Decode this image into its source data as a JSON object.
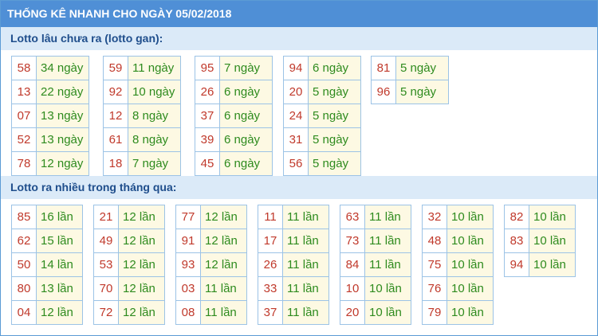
{
  "title": "THỐNG KÊ NHANH CHO NGÀY 05/02/2018",
  "gan": {
    "heading": "Lotto lâu chưa ra (lotto gan):",
    "groups": [
      [
        [
          "58",
          "34 ngày"
        ],
        [
          "13",
          "22 ngày"
        ],
        [
          "07",
          "13 ngày"
        ],
        [
          "52",
          "13 ngày"
        ],
        [
          "78",
          "12 ngày"
        ]
      ],
      [
        [
          "59",
          "11 ngày"
        ],
        [
          "92",
          "10 ngày"
        ],
        [
          "12",
          "8 ngày"
        ],
        [
          "61",
          "8 ngày"
        ],
        [
          "18",
          "7 ngày"
        ]
      ],
      [
        [
          "95",
          "7 ngày"
        ],
        [
          "26",
          "6 ngày"
        ],
        [
          "37",
          "6 ngày"
        ],
        [
          "39",
          "6 ngày"
        ],
        [
          "45",
          "6 ngày"
        ]
      ],
      [
        [
          "94",
          "6 ngày"
        ],
        [
          "20",
          "5 ngày"
        ],
        [
          "24",
          "5 ngày"
        ],
        [
          "31",
          "5 ngày"
        ],
        [
          "56",
          "5 ngày"
        ]
      ],
      [
        [
          "81",
          "5 ngày"
        ],
        [
          "96",
          "5 ngày"
        ]
      ]
    ]
  },
  "nhieu": {
    "heading": "Lotto ra nhiều trong tháng qua:",
    "groups": [
      [
        [
          "85",
          "16 lần"
        ],
        [
          "62",
          "15 lần"
        ],
        [
          "50",
          "14 lần"
        ],
        [
          "80",
          "13 lần"
        ],
        [
          "04",
          "12 lần"
        ]
      ],
      [
        [
          "21",
          "12 lần"
        ],
        [
          "49",
          "12 lần"
        ],
        [
          "53",
          "12 lần"
        ],
        [
          "70",
          "12 lần"
        ],
        [
          "72",
          "12 lần"
        ]
      ],
      [
        [
          "77",
          "12 lần"
        ],
        [
          "91",
          "12 lần"
        ],
        [
          "93",
          "12 lần"
        ],
        [
          "03",
          "11 lần"
        ],
        [
          "08",
          "11 lần"
        ]
      ],
      [
        [
          "11",
          "11 lần"
        ],
        [
          "17",
          "11 lần"
        ],
        [
          "26",
          "11 lần"
        ],
        [
          "33",
          "11 lần"
        ],
        [
          "37",
          "11 lần"
        ]
      ],
      [
        [
          "63",
          "11 lần"
        ],
        [
          "73",
          "11 lần"
        ],
        [
          "84",
          "11 lần"
        ],
        [
          "10",
          "10 lần"
        ],
        [
          "20",
          "10 lần"
        ]
      ],
      [
        [
          "32",
          "10 lần"
        ],
        [
          "48",
          "10 lần"
        ],
        [
          "75",
          "10 lần"
        ],
        [
          "76",
          "10 lần"
        ],
        [
          "79",
          "10 lần"
        ]
      ],
      [
        [
          "82",
          "10 lần"
        ],
        [
          "83",
          "10 lần"
        ],
        [
          "94",
          "10 lần"
        ]
      ]
    ]
  }
}
